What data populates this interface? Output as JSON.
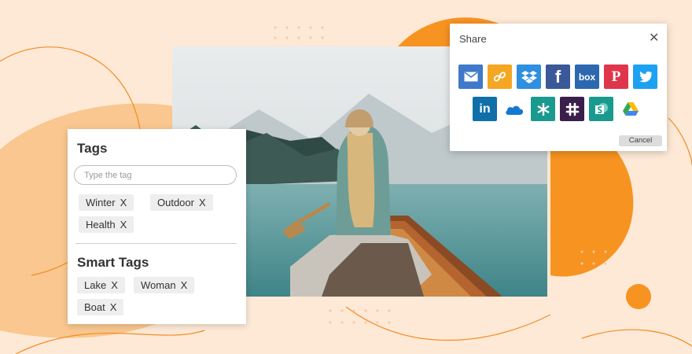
{
  "tags_panel": {
    "title": "Tags",
    "input_placeholder": "Type the tag",
    "tags": [
      {
        "label": "Winter",
        "remove": "X"
      },
      {
        "label": "Outdoor",
        "remove": "X"
      },
      {
        "label": "Health",
        "remove": "X"
      }
    ],
    "smart_title": "Smart Tags",
    "smart_tags": [
      {
        "label": "Lake",
        "remove": "X"
      },
      {
        "label": "Woman",
        "remove": "X"
      },
      {
        "label": "Boat",
        "remove": "X"
      }
    ]
  },
  "share_dialog": {
    "title": "Share",
    "close": "✕",
    "cancel_label": "Cancel",
    "row1": [
      {
        "icon": "email-icon",
        "glyph": "✉",
        "color": "#3f79c9"
      },
      {
        "icon": "link-icon",
        "glyph": "🔗",
        "color": "#f5a623"
      },
      {
        "icon": "dropbox-icon",
        "glyph": "⧫",
        "color": "#2f8fe0"
      },
      {
        "icon": "facebook-icon",
        "glyph": "f",
        "color": "#3b5998"
      },
      {
        "icon": "box-icon",
        "glyph": "box",
        "color": "#2c68b0"
      },
      {
        "icon": "pinterest-icon",
        "glyph": "P",
        "color": "#e0364b"
      },
      {
        "icon": "twitter-icon",
        "glyph": "🐦",
        "color": "#1da1f2"
      }
    ],
    "row2": [
      {
        "icon": "linkedin-icon",
        "glyph": "in",
        "color": "#0f6fa8"
      },
      {
        "icon": "onedrive-icon",
        "glyph": "☁",
        "color": "#ffffff"
      },
      {
        "icon": "sharefile-icon",
        "glyph": "✳",
        "color": "#1a9a8e"
      },
      {
        "icon": "slack-icon",
        "glyph": "#",
        "color": "#3a1f4d"
      },
      {
        "icon": "sharepoint-icon",
        "glyph": "S",
        "color": "#1a9a8e"
      },
      {
        "icon": "google-drive-icon",
        "glyph": "▲",
        "color": "#ffffff"
      }
    ]
  }
}
